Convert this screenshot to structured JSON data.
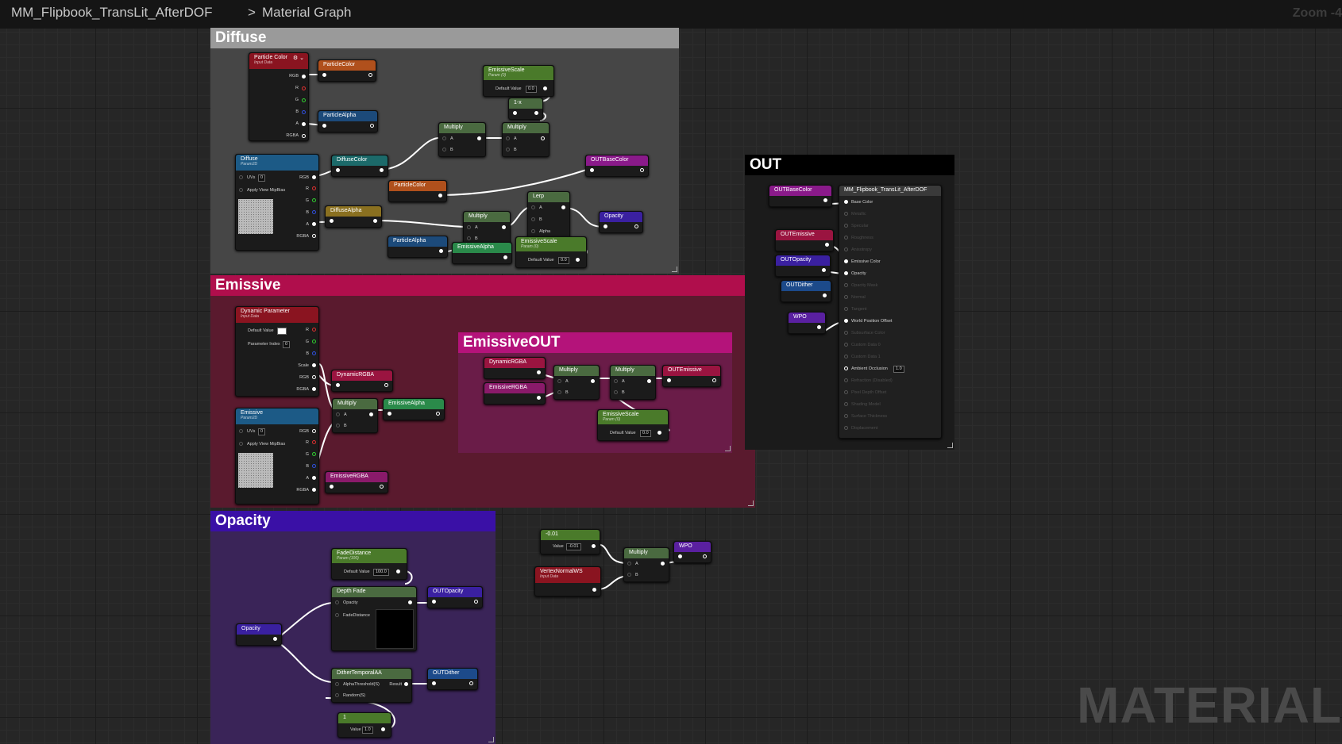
{
  "header": {
    "asset_name": "MM_Flipbook_TransLit_AfterDOF",
    "separator": ">",
    "graph_name": "Material Graph",
    "zoom_label": "Zoom -4"
  },
  "watermark": "MATERIAL",
  "comments": {
    "diffuse": "Diffuse",
    "emissive": "Emissive",
    "emissive_out": "EmissiveOUT",
    "opacity": "Opacity",
    "out": "OUT"
  },
  "colors": {
    "diffuse_header": "#9a9a9a",
    "diffuse_body": "#464646",
    "emissive_header": "#b00e4c",
    "emissive_body": "#5a1a2e",
    "emissiveout_header": "#b4137a",
    "emissiveout_body": "#6a1c48",
    "opacity_header": "#3a10a6",
    "opacity_body": "#3a2458",
    "out_header": "#000000",
    "out_body": "#1b1b1b"
  },
  "nodes": {
    "particle_color": {
      "title": "Particle Color",
      "subtitle": "Input Data",
      "pins": [
        "RGB",
        "R",
        "G",
        "B",
        "A",
        "RGBA"
      ]
    },
    "particle_color_reroute": {
      "title": "ParticleColor"
    },
    "particle_alpha": {
      "title": "ParticleAlpha"
    },
    "emissive_scale_param": {
      "title": "EmissiveScale",
      "subtitle": "Param (0)",
      "label": "Default Value",
      "value": "0.0"
    },
    "one_minus": {
      "title": "1-x"
    },
    "multiply_1": {
      "title": "Multiply",
      "a": "A",
      "b": "B"
    },
    "multiply_2": {
      "title": "Multiply",
      "a": "A",
      "b": "B"
    },
    "diffuse_tex": {
      "title": "Diffuse",
      "subtitle": "Param2D",
      "uvs": "UVs",
      "uvs_val": "0",
      "mip": "Apply View MipBias",
      "pins": [
        "RGB",
        "R",
        "G",
        "B",
        "A",
        "RGBA"
      ]
    },
    "diffuse_color": {
      "title": "DiffuseColor"
    },
    "particle_color_2": {
      "title": "ParticleColor"
    },
    "out_base_color_set": {
      "title": "OUTBaseColor"
    },
    "diffuse_alpha": {
      "title": "DiffuseAlpha"
    },
    "multiply_3": {
      "title": "Multiply",
      "a": "A",
      "b": "B"
    },
    "lerp": {
      "title": "Lerp",
      "a": "A",
      "b": "B",
      "alpha": "Alpha"
    },
    "opacity_set": {
      "title": "Opacity"
    },
    "particle_alpha_2": {
      "title": "ParticleAlpha"
    },
    "emissive_alpha_get": {
      "title": "EmissiveAlpha"
    },
    "emissive_scale_2": {
      "title": "EmissiveScale",
      "subtitle": "Param (0)",
      "label": "Default Value",
      "value": "0.0"
    },
    "dynamic_param": {
      "title": "Dynamic Parameter",
      "subtitle": "Input Data",
      "default_label": "Default Value",
      "index_label": "Parameter Index",
      "index_val": "0",
      "pins": [
        "R",
        "G",
        "B",
        "Scale",
        "RGB",
        "RGBA"
      ]
    },
    "dynamic_rgba_set": {
      "title": "DynamicRGBA"
    },
    "multiply_e1": {
      "title": "Multiply",
      "a": "A",
      "b": "B"
    },
    "emissive_alpha_set": {
      "title": "EmissiveAlpha"
    },
    "emissive_tex": {
      "title": "Emissive",
      "subtitle": "Param2D",
      "uvs": "UVs",
      "uvs_val": "0",
      "mip": "Apply View MipBias",
      "pins": [
        "RGB",
        "R",
        "G",
        "B",
        "A",
        "RGBA"
      ]
    },
    "emissive_rgba_set": {
      "title": "EmissiveRGBA"
    },
    "dynamic_rgba_get": {
      "title": "DynamicRGBA"
    },
    "emissive_rgba_get": {
      "title": "EmissiveRGBA"
    },
    "multiply_o1": {
      "title": "Multiply",
      "a": "A",
      "b": "B"
    },
    "multiply_o2": {
      "title": "Multiply",
      "a": "A",
      "b": "B"
    },
    "out_emissive_set": {
      "title": "OUTEmissive"
    },
    "emissive_scale_3": {
      "title": "EmissiveScale",
      "subtitle": "Param (0)",
      "label": "Default Value",
      "value": "0.0"
    },
    "fade_distance": {
      "title": "FadeDistance",
      "subtitle": "Param (100)",
      "label": "Default Value",
      "value": "100.0"
    },
    "depth_fade": {
      "title": "Depth Fade",
      "opacity": "Opacity",
      "fade": "FadeDistance"
    },
    "out_opacity_set": {
      "title": "OUTOpacity"
    },
    "opacity_get": {
      "title": "Opacity"
    },
    "dither": {
      "title": "DitherTemporalAA",
      "alpha": "AlphaThreshold(S)",
      "result": "Result",
      "random": "Random(S)"
    },
    "out_dither_set": {
      "title": "OUTDither"
    },
    "const_one": {
      "title": "1",
      "label": "Value",
      "value": "1.0"
    },
    "const_neg": {
      "title": "-0.01",
      "label": "Value",
      "value": "-0.01"
    },
    "vertex_normal": {
      "title": "VertexNormalWS",
      "subtitle": "Input Data"
    },
    "multiply_w": {
      "title": "Multiply",
      "a": "A",
      "b": "B"
    },
    "wpo_set": {
      "title": "WPO"
    },
    "out_base_color_get": {
      "title": "OUTBaseColor"
    },
    "out_emissive_get": {
      "title": "OUTEmissive"
    },
    "out_opacity_get": {
      "title": "OUTOpacity"
    },
    "out_dither_get": {
      "title": "OUTDither"
    },
    "wpo_get": {
      "title": "WPO"
    },
    "result": {
      "title": "MM_Flipbook_TransLit_AfterDOF",
      "pins": [
        {
          "label": "Base Color",
          "active": true
        },
        {
          "label": "Metallic",
          "active": false
        },
        {
          "label": "Specular",
          "active": false
        },
        {
          "label": "Roughness",
          "active": false
        },
        {
          "label": "Anisotropy",
          "active": false
        },
        {
          "label": "Emissive Color",
          "active": true
        },
        {
          "label": "Opacity",
          "active": true
        },
        {
          "label": "Opacity Mask",
          "active": false
        },
        {
          "label": "Normal",
          "active": false
        },
        {
          "label": "Tangent",
          "active": false
        },
        {
          "label": "World Position Offset",
          "active": true
        },
        {
          "label": "Subsurface Color",
          "active": false
        },
        {
          "label": "Custom Data 0",
          "active": false
        },
        {
          "label": "Custom Data 1",
          "active": false
        },
        {
          "label": "Ambient Occlusion",
          "active": true,
          "value": "1.0"
        },
        {
          "label": "Refraction (Disabled)",
          "active": false
        },
        {
          "label": "Pixel Depth Offset",
          "active": false
        },
        {
          "label": "Shading Model",
          "active": false
        },
        {
          "label": "Surface Thickness",
          "active": false
        },
        {
          "label": "Displacement",
          "active": false
        }
      ]
    }
  }
}
